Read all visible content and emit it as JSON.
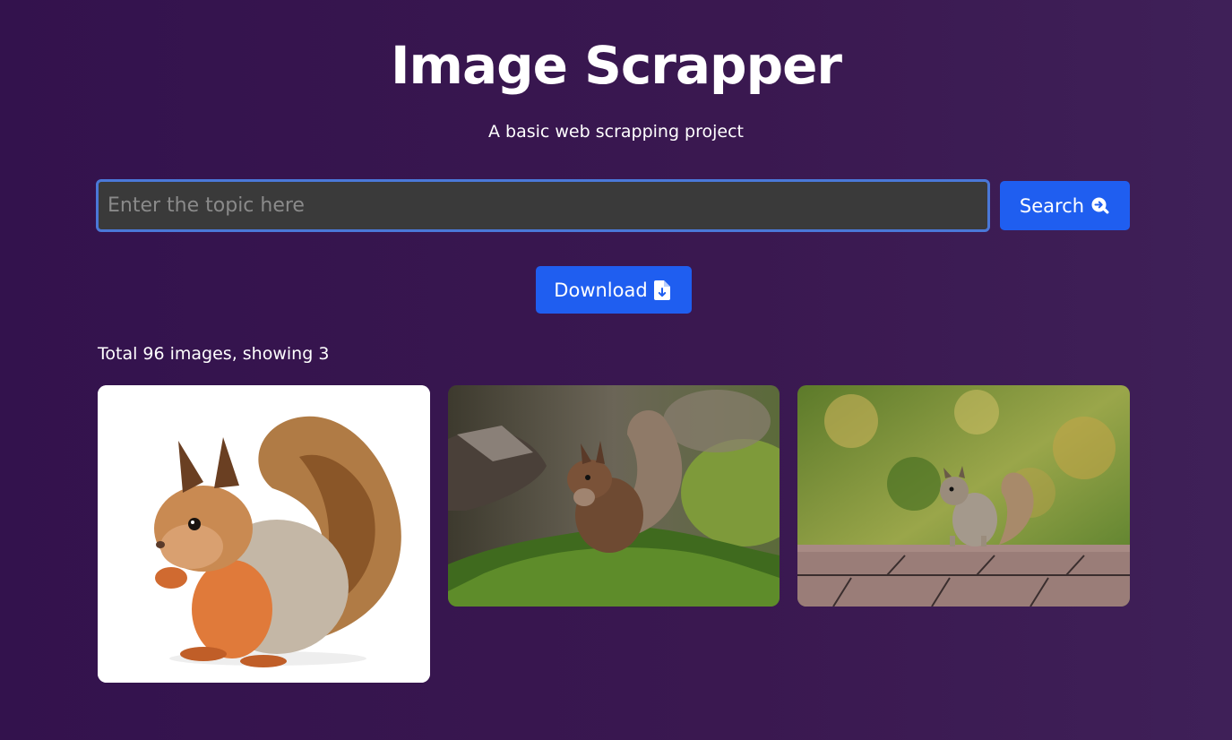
{
  "header": {
    "title": "Image Scrapper",
    "subtitle": "A basic web scrapping project"
  },
  "search": {
    "placeholder": "Enter the topic here",
    "value": "",
    "button_label": "Search",
    "button_icon": "magnifier-arrow-icon"
  },
  "download": {
    "button_label": "Download",
    "button_icon": "file-download-icon"
  },
  "results": {
    "status_text": "Total 96 images, showing 3",
    "images": [
      {
        "subject": "squirrel-eating-white-background"
      },
      {
        "subject": "red-squirrel-on-mossy-log"
      },
      {
        "subject": "gray-squirrel-on-roof"
      }
    ]
  },
  "colors": {
    "background": "#33124d",
    "accent_button": "#1f5ef0",
    "input_border": "#4a78d8",
    "input_background": "#3a3a3a"
  }
}
